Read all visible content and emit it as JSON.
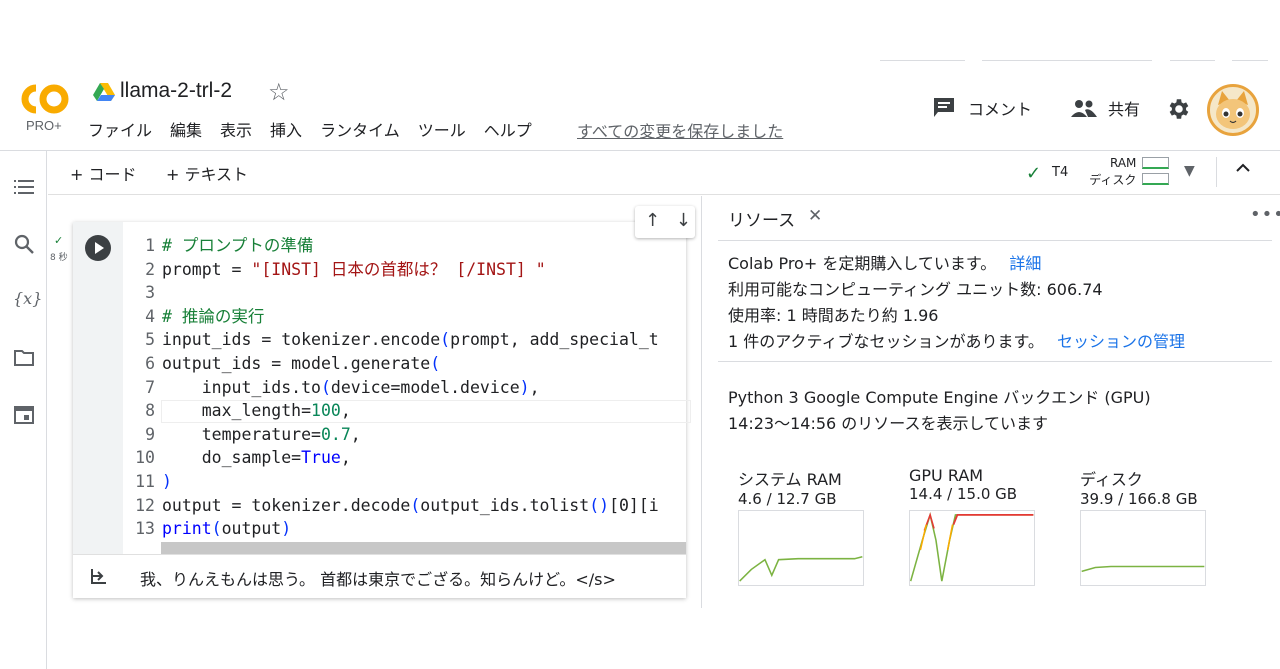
{
  "header": {
    "logo_text": "CO",
    "logo_badge": "PRO+",
    "title": "llama-2-trl-2",
    "menu": [
      "ファイル",
      "編集",
      "表示",
      "挿入",
      "ランタイム",
      "ツール",
      "ヘルプ"
    ],
    "save_status": "すべての変更を保存しました",
    "comment_label": "コメント",
    "share_label": "共有"
  },
  "toolbar": {
    "add_code": "+ コード",
    "add_text": "+ テキスト",
    "runtime": "T4",
    "ram_label": "RAM",
    "disk_label": "ディスク"
  },
  "cell": {
    "exec_time": "8 秒",
    "lines": [
      {
        "n": "1",
        "html": "<span class=\"cm\"># プロンプトの準備</span>"
      },
      {
        "n": "2",
        "html": "prompt = <span class=\"st\">\"[INST] 日本の首都は？ [/INST] \"</span>"
      },
      {
        "n": "3",
        "html": ""
      },
      {
        "n": "4",
        "html": "<span class=\"cm\"># 推論の実行</span>"
      },
      {
        "n": "5",
        "html": "input_ids = tokenizer.encode<span class=\"pa\">(</span>prompt, add_special_t"
      },
      {
        "n": "6",
        "html": "output_ids = model.generate<span class=\"pa\">(</span>"
      },
      {
        "n": "7",
        "html": "    input_ids.to<span class=\"pa\">(</span>device=model.device<span class=\"pa\">)</span>,"
      },
      {
        "n": "8",
        "html": "    max_length=<span class=\"nm\">100</span>,"
      },
      {
        "n": "9",
        "html": "    temperature=<span class=\"nm\">0.7</span>,"
      },
      {
        "n": "10",
        "html": "    do_sample=<span class=\"kw\">True</span>,"
      },
      {
        "n": "11",
        "html": "<span class=\"pa\">)</span>"
      },
      {
        "n": "12",
        "html": "output = tokenizer.decode<span class=\"pa\">(</span>output_ids.tolist<span class=\"pa\">()</span>[0][i"
      },
      {
        "n": "13",
        "html": "<span class=\"kw\">print</span><span class=\"pa\">(</span>output<span class=\"pa\">)</span>"
      }
    ],
    "output": "我、りんえもんは思う。 首都は東京でござる。知らんけど。</s>"
  },
  "resources": {
    "tab_label": "リソース",
    "subscription": "Colab Pro+ を定期購入しています。",
    "details_link": "詳細",
    "units": "利用可能なコンピューティング ユニット数: 606.74",
    "usage": "使用率: 1 時間あたり約 1.96",
    "sessions": "1 件のアクティブなセッションがあります。",
    "manage_link": "セッションの管理",
    "backend": "Python 3 Google Compute Engine バックエンド (GPU)",
    "period": "14:23～14:56 のリソースを表示しています",
    "gauges": [
      {
        "title": "システム RAM",
        "value": "4.6 / 12.7 GB",
        "fraction": 0.36
      },
      {
        "title": "GPU RAM",
        "value": "14.4 / 15.0 GB",
        "fraction": 0.96
      },
      {
        "title": "ディスク",
        "value": "39.9 / 166.8 GB",
        "fraction": 0.24
      }
    ]
  },
  "colors": {
    "accent": "#f9ab00",
    "link": "#1a73e8",
    "ok": "#188038"
  }
}
